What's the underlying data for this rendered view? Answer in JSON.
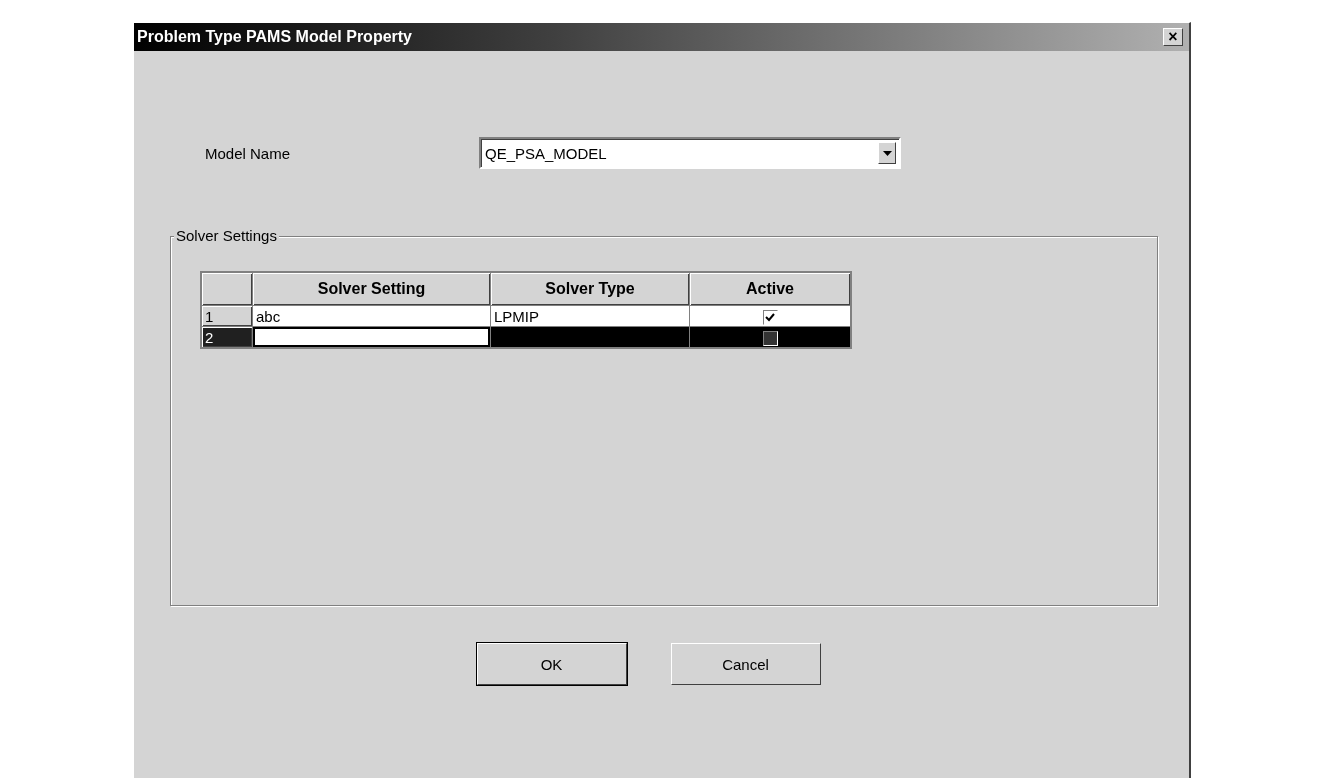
{
  "window": {
    "title": "Problem Type PAMS Model Property",
    "close": "×"
  },
  "model_name": {
    "label": "Model Name",
    "value": "QE_PSA_MODEL"
  },
  "solver_settings": {
    "title": "Solver Settings",
    "columns": [
      "Solver Setting",
      "Solver Type",
      "Active"
    ],
    "rows": [
      {
        "number": "1",
        "solver_setting": "abc",
        "solver_type": "LPMIP",
        "active": true,
        "selected": false
      },
      {
        "number": "2",
        "active": false,
        "selected": true
      }
    ]
  },
  "buttons": [
    {
      "label": "OK",
      "default": true
    },
    {
      "label": "Cancel",
      "default": false
    }
  ]
}
